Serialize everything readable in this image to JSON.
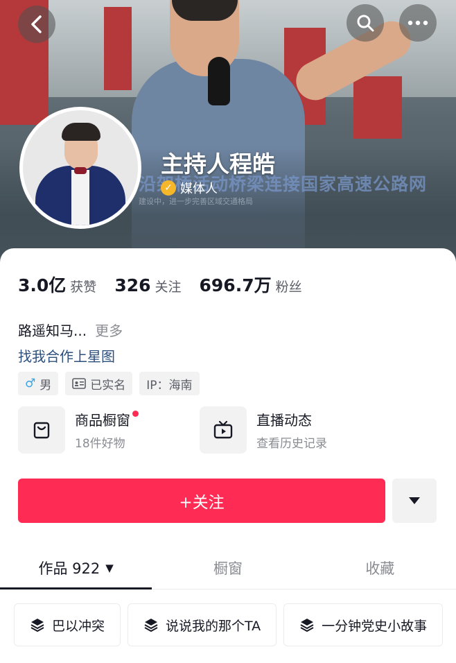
{
  "header": {
    "name": "主持人程皓",
    "verified_label": "媒体人",
    "caption": "沿架桥活动桥梁连接国家高速公路网",
    "caption_small": "建设中，进一步完善区域交通格局"
  },
  "stats": [
    {
      "value": "3.0亿",
      "label": "获赞"
    },
    {
      "value": "326",
      "label": "关注"
    },
    {
      "value": "696.7万",
      "label": "粉丝"
    }
  ],
  "bio": {
    "text": "路遥知马...",
    "more": "更多"
  },
  "collab_link": "找我合作上星图",
  "tags": {
    "gender_symbol": "♂",
    "gender": "男",
    "realname": "已实名",
    "ip": "IP：海南"
  },
  "features": {
    "shop": {
      "title": "商品橱窗",
      "sub": "18件好物"
    },
    "live": {
      "title": "直播动态",
      "sub": "查看历史记录"
    }
  },
  "follow_label": "+关注",
  "tabs": [
    {
      "label": "作品 922"
    },
    {
      "label": "橱窗"
    },
    {
      "label": "收藏"
    }
  ],
  "collections": [
    {
      "label": "巴以冲突"
    },
    {
      "label": "说说我的那个TA"
    },
    {
      "label": "一分钟党史小故事"
    }
  ],
  "colors": {
    "accent": "#fe2c55",
    "link": "#2c4f7c",
    "verified": "#f5b62a"
  }
}
